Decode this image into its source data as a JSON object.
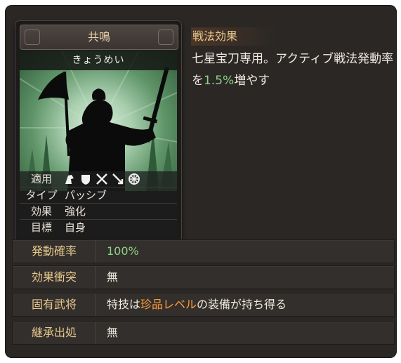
{
  "card": {
    "name": "共鳴",
    "reading": "きょうめい",
    "props": [
      {
        "key": "適用",
        "value": ""
      },
      {
        "key": "タイプ",
        "value": "パッシブ"
      },
      {
        "key": "効果",
        "value": "強化"
      },
      {
        "key": "目標",
        "value": "自身"
      }
    ],
    "applicable_icons": [
      "horse-icon",
      "shield-icon",
      "crossed-weapons-icon",
      "arrow-icon",
      "wheel-icon"
    ]
  },
  "effect": {
    "heading": "戦法効果",
    "text_before": "七星宝刀専用。アクティブ戦法発動率を",
    "rate": "1.5%",
    "text_after": "増やす"
  },
  "stats": [
    {
      "label": "発動確率",
      "value": "100%"
    },
    {
      "label": "効果衝突",
      "value": "無"
    },
    {
      "label": "固有武将",
      "value_before": "特技は",
      "value_highlight": "珍品レベル",
      "value_after": "の装備が持ち得る"
    },
    {
      "label": "継承出処",
      "value": "無"
    }
  ],
  "colors": {
    "panel": "#2a2725",
    "gold_label": "#e7c98e",
    "green_value": "#8fd18a",
    "orange_highlight": "#ff9c3a"
  }
}
